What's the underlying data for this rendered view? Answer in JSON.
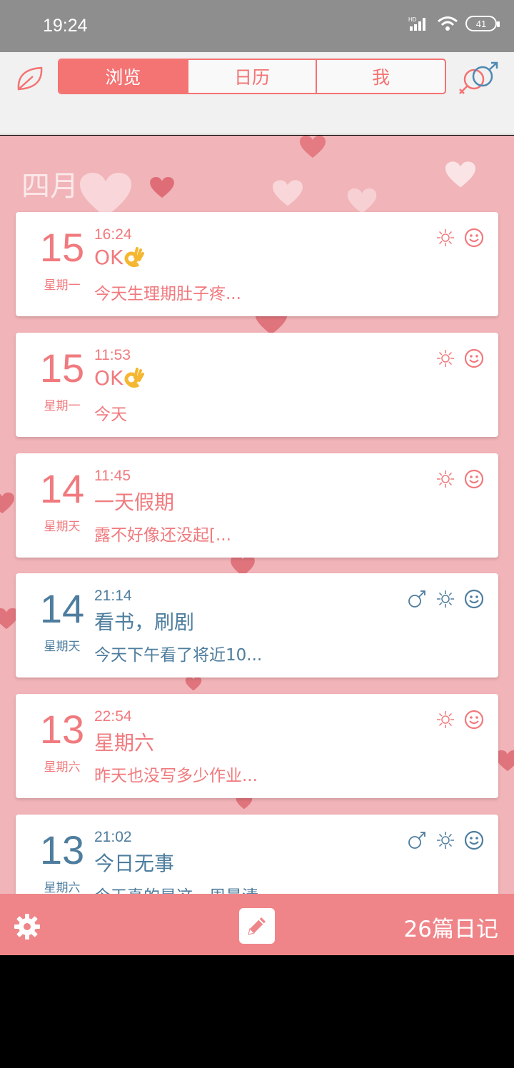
{
  "status_bar": {
    "time": "19:24",
    "battery": "41",
    "network": "HD"
  },
  "header": {
    "tabs": [
      {
        "label": "浏览",
        "active": true
      },
      {
        "label": "日历",
        "active": false
      },
      {
        "label": "我",
        "active": false
      }
    ],
    "accent_color": "#f47373"
  },
  "main": {
    "month": "四月",
    "entries": [
      {
        "day": "15",
        "weekday": "星期一",
        "time": "16:24",
        "title": "OK",
        "title_emoji": true,
        "preview": "今天生理期肚子疼...",
        "color": "pink",
        "icons": [
          "sun-icon",
          "smiley-icon"
        ]
      },
      {
        "day": "15",
        "weekday": "星期一",
        "time": "11:53",
        "title": "OK",
        "title_emoji": true,
        "preview": "今天",
        "color": "pink",
        "icons": [
          "sun-icon",
          "smiley-icon"
        ]
      },
      {
        "day": "14",
        "weekday": "星期天",
        "time": "11:45",
        "title": "一天假期",
        "title_emoji": false,
        "preview": "露不好像还没起[...",
        "color": "pink",
        "icons": [
          "sun-icon",
          "smiley-icon"
        ]
      },
      {
        "day": "14",
        "weekday": "星期天",
        "time": "21:14",
        "title": "看书，刷剧",
        "title_emoji": false,
        "preview": "今天下午看了将近10...",
        "color": "blue",
        "icons": [
          "male-icon",
          "sun-icon",
          "smiley-icon"
        ]
      },
      {
        "day": "13",
        "weekday": "星期六",
        "time": "22:54",
        "title": "星期六",
        "title_emoji": false,
        "preview": "昨天也没写多少作业...",
        "color": "pink",
        "icons": [
          "sun-icon",
          "smiley-icon"
        ]
      },
      {
        "day": "13",
        "weekday": "星期六",
        "time": "21:02",
        "title": "今日无事",
        "title_emoji": false,
        "preview": "今天真的是这一周最清",
        "color": "blue",
        "icons": [
          "male-icon",
          "sun-icon",
          "smiley-icon"
        ]
      }
    ]
  },
  "bottom_bar": {
    "count_label": "26篇日记"
  },
  "colors": {
    "pink": "#f07a7e",
    "blue": "#4e7d9e",
    "background": "#f1b4b8",
    "bar": "#ef8589"
  }
}
